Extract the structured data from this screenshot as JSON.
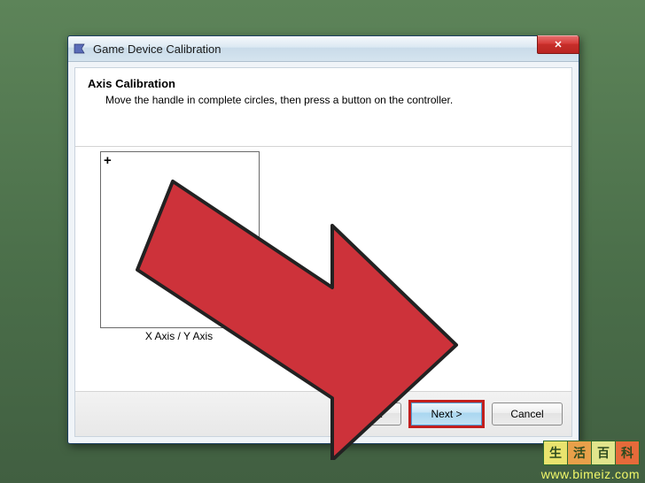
{
  "window": {
    "title": "Game Device Calibration",
    "close_label": "✕"
  },
  "header": {
    "title": "Axis Calibration",
    "desc": "Move the handle in complete circles, then press a button on the controller."
  },
  "axis": {
    "crosshair": "+",
    "label": "X Axis / Y Axis"
  },
  "footer": {
    "back": "< Back",
    "next": "Next >",
    "cancel": "Cancel"
  },
  "watermark": {
    "c1": "生",
    "c2": "活",
    "c3": "百",
    "c4": "科",
    "url": "www.bimeiz.com"
  }
}
